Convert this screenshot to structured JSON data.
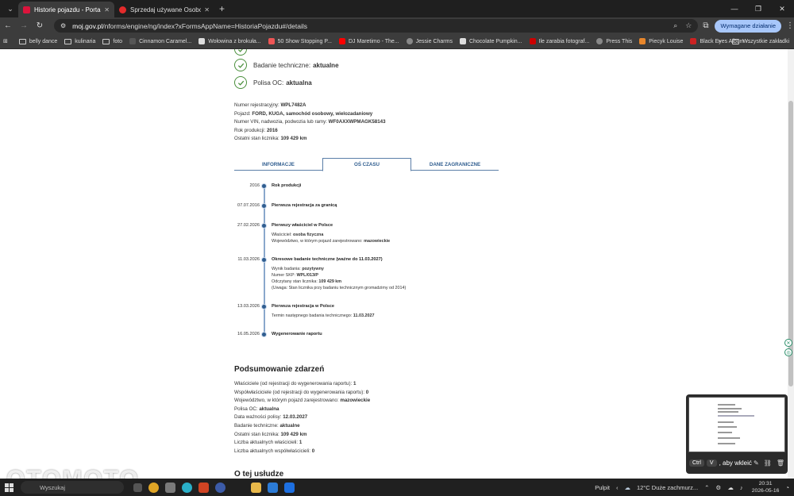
{
  "browser": {
    "tabs": [
      {
        "title": "Historie pojazdu - Portal gov.pl",
        "active": true,
        "color": "#dc143c"
      },
      {
        "title": "Sprzedaj używane Osobowe | O",
        "active": false,
        "color": "#e32b2b"
      }
    ],
    "url_host": "moj.gov.pl",
    "url_path": "/nforms/engine/ng/index?xFormsAppName=HistoriaPojazdu#/details",
    "action_button": "Wymagane działanie",
    "bookmarks": [
      {
        "label": "belly dance",
        "type": "folder"
      },
      {
        "label": "kulinaria",
        "type": "folder"
      },
      {
        "label": "foto",
        "type": "folder"
      },
      {
        "label": "Cinnamon Caramel...",
        "type": "icon",
        "color": "#333"
      },
      {
        "label": "Wołowina z brokuła...",
        "type": "icon",
        "color": "#ddd"
      },
      {
        "label": "50 Show Stopping P...",
        "type": "icon",
        "color": "#e55"
      },
      {
        "label": "DJ Maretimo - The...",
        "type": "icon",
        "color": "#f00"
      },
      {
        "label": "Jessie Charms",
        "type": "icon",
        "color": "#888"
      },
      {
        "label": "Chocolate Pumpkin...",
        "type": "icon",
        "color": "#ddd"
      },
      {
        "label": "Ile zarabia fotograf...",
        "type": "icon",
        "color": "#c00"
      },
      {
        "label": "Press This",
        "type": "icon",
        "color": "#888"
      },
      {
        "label": "Piecyk Louise",
        "type": "icon",
        "color": "#e7862b"
      },
      {
        "label": "Black Eyes Album -...",
        "type": "icon",
        "color": "#c22"
      }
    ],
    "bookmarks_all": "Wszystkie zakładki"
  },
  "status": [
    {
      "label": "Badanie techniczne:",
      "value": "aktualne"
    },
    {
      "label": "Polisa OC:",
      "value": "aktualna"
    }
  ],
  "details": [
    {
      "label": "Numer rejestracyjny:",
      "value": "WPL7482A"
    },
    {
      "label": "Pojazd:",
      "value": "FORD, KUGA, samochód osobowy, wielozadaniowy"
    },
    {
      "label": "Numer VIN, nadwozia, podwozia lub ramy:",
      "value": "WF0AXXWPMAGK58143"
    },
    {
      "label": "Rok produkcji:",
      "value": "2016"
    },
    {
      "label": "Ostatni stan licznika:",
      "value": "109 429 km"
    }
  ],
  "page_tabs": [
    {
      "label": "INFORMACJE",
      "selected": false
    },
    {
      "label": "OŚ CZASU",
      "selected": true
    },
    {
      "label": "DANE ZAGRANICZNE",
      "selected": false
    }
  ],
  "timeline": [
    {
      "date": "2016",
      "title": "Rok produkcji",
      "details": []
    },
    {
      "date": "07.07.2016",
      "title": "Pierwsza rejestracja za granicą",
      "details": []
    },
    {
      "date": "27.02.2026",
      "title": "Pierwszy właściciel w Polsce",
      "details": [
        {
          "label": "Właściciel:",
          "value": "osoba fizyczna"
        },
        {
          "label": "Województwo, w którym pojazd zarejestrowano:",
          "value": "mazowieckie"
        }
      ]
    },
    {
      "date": "11.03.2026",
      "title": "Okresowe badanie techniczne (ważne do 11.03.2027)",
      "details": [
        {
          "label": "Wynik badania:",
          "value": "pozytywny"
        },
        {
          "label": "Numer SKP:",
          "value": "WPL/013/P"
        },
        {
          "label": "Odczytany stan licznika:",
          "value": "109 429 km"
        },
        {
          "label": "(Uwaga: Stan licznika przy badaniu technicznym gromadzimy od 2014)",
          "value": ""
        }
      ]
    },
    {
      "date": "13.03.2026",
      "title": "Pierwsza rejestracja w Polsce",
      "details": [
        {
          "label": "Termin następnego badania technicznego:",
          "value": "11.03.2027"
        }
      ]
    },
    {
      "date": "16.05.2026",
      "title": "Wygenerowanie raportu",
      "details": []
    }
  ],
  "summary": {
    "heading": "Podsumowanie zdarzeń",
    "rows": [
      {
        "label": "Właściciele (od rejestracji do wygenerowania raportu):",
        "value": "1"
      },
      {
        "label": "Współwłaściciele (od rejestracji do wygenerowania raportu):",
        "value": "0"
      },
      {
        "label": "Województwo, w którym pojazd zarejestrowano:",
        "value": "mazowieckie"
      },
      {
        "label": "Polisa OC:",
        "value": "aktualna"
      },
      {
        "label": "Data ważności polisy:",
        "value": "12.03.2027"
      },
      {
        "label": "Badanie techniczne:",
        "value": "aktualne"
      },
      {
        "label": "Ostatni stan licznika:",
        "value": "109 429 km"
      },
      {
        "label": "Liczba aktualnych właścicieli:",
        "value": "1"
      },
      {
        "label": "Liczba aktualnych współwłaścicieli:",
        "value": "0"
      }
    ]
  },
  "about_heading": "O tej usłudze",
  "clipboard": {
    "key1": "Ctrl",
    "key2": "V",
    "hint": ", aby wkleić"
  },
  "watermark": "OTOMOTO",
  "taskbar": {
    "search": "Wyszukaj",
    "desktop": "Pulpit",
    "weather": "12°C  Duże zachmurz...",
    "time": "20:31",
    "date": "2026-05-16"
  }
}
